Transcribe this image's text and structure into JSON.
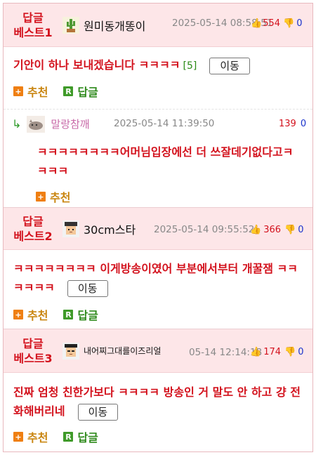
{
  "comments": [
    {
      "best_label_line1": "답글",
      "best_label_line2": "베스트1",
      "nickname": "원미동개똥이",
      "date": "2025-05-14 08:58:51",
      "up": "554",
      "down": "0",
      "text": "기안이 하나 보내겠습니다 ㅋㅋㅋㅋ",
      "reply_count": "[5]",
      "move_label": "이동",
      "recommend_label": "추천",
      "reply_label": "답글"
    },
    {
      "best_label_line1": "답글",
      "best_label_line2": "베스트2",
      "nickname": "30cm스타",
      "date": "2025-05-14 09:55:52",
      "up": "366",
      "down": "0",
      "text": "ㅋㅋㅋㅋㅋㅋㅋㅋ 이게방송이였어 부분에서부터 개꿀잼 ㅋㅋㅋㅋㅋㅋ",
      "move_label": "이동",
      "recommend_label": "추천",
      "reply_label": "답글"
    },
    {
      "best_label_line1": "답글",
      "best_label_line2": "베스트3",
      "nickname": "내어찌그대를이즈리얼",
      "date": "05-14 12:14:18",
      "up": "174",
      "down": "0",
      "text": "진짜 엄청 친한가보다 ㅋㅋㅋㅋ 방송인 거 말도 안 하고 걍 전화해버리네",
      "move_label": "이동",
      "recommend_label": "추천",
      "reply_label": "답글"
    }
  ],
  "reply": {
    "nickname": "말랑참깨",
    "date": "2025-05-14 11:39:50",
    "up": "139",
    "down": "0",
    "text": "ㅋㅋㅋㅋㅋㅋㅋㅋ어머님입장에선 더 쓰잘데기없다고ㅋㅋㅋㅋ",
    "recommend_label": "추천"
  },
  "icons": {
    "thumb_up": "thumbs-up-icon",
    "thumb_down": "thumbs-down-icon",
    "recommend": "plus-icon",
    "reply": "reply-icon",
    "reply_arrow": "reply-arrow-icon"
  },
  "colors": {
    "best_bg": "#fde6e8",
    "accent_red": "#d3121d",
    "down_blue": "#1a33cc",
    "recommend_orange": "#ef7f12",
    "reply_green": "#3f9a29"
  }
}
